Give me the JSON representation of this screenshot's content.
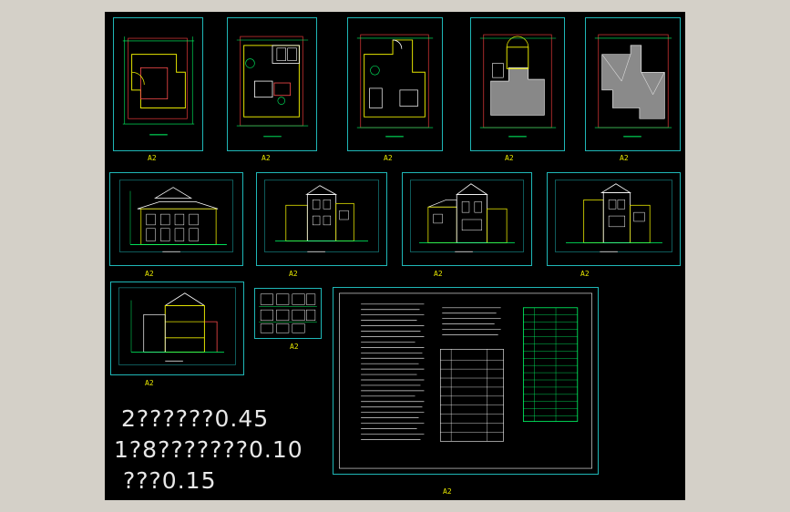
{
  "app": {
    "background_color": "#000000",
    "frame_color": "#1fb7b7"
  },
  "sheets": {
    "floor_plans": [
      {
        "label": "A2",
        "kind": "floor-plan"
      },
      {
        "label": "A2",
        "kind": "floor-plan"
      },
      {
        "label": "A2",
        "kind": "floor-plan"
      },
      {
        "label": "A2",
        "kind": "floor-plan"
      },
      {
        "label": "A2",
        "kind": "roof-plan"
      }
    ],
    "elevations": [
      {
        "label": "A2"
      },
      {
        "label": "A2"
      },
      {
        "label": "A2"
      },
      {
        "label": "A2"
      }
    ],
    "section": {
      "label": "A2"
    },
    "details": {
      "label": "A2"
    },
    "notes": {
      "label": "A2"
    }
  },
  "scale_notes": [
    "2??????0.45",
    "1?8???????0.10",
    "???0.15"
  ]
}
